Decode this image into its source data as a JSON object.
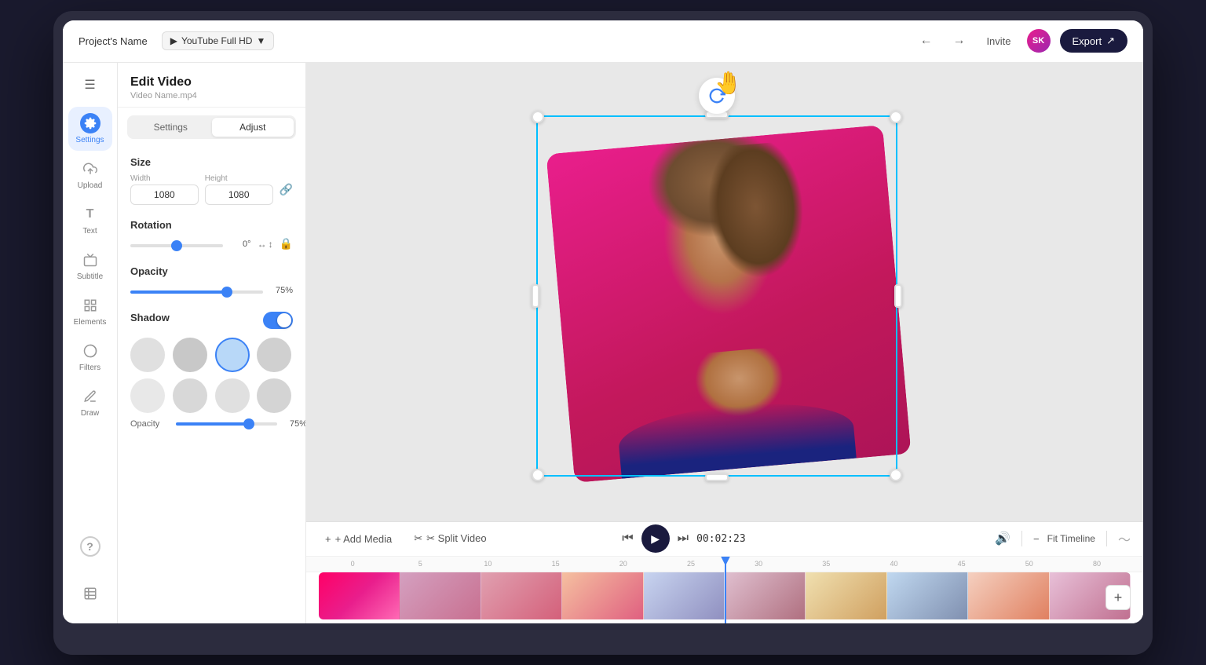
{
  "header": {
    "project_name": "Project's Name",
    "format_label": "YouTube Full HD",
    "undo_icon": "←",
    "redo_icon": "→",
    "invite_label": "Invite",
    "user_initials": "SK",
    "export_label": "Export",
    "share_icon": "↗"
  },
  "left_toolbar": {
    "menu_icon": "☰",
    "items": [
      {
        "id": "settings",
        "label": "Settings",
        "icon": "⚙",
        "active": true
      },
      {
        "id": "upload",
        "label": "Upload",
        "icon": "↑",
        "active": false
      },
      {
        "id": "text",
        "label": "Text",
        "icon": "T",
        "active": false
      },
      {
        "id": "subtitle",
        "label": "Subtitle",
        "icon": "≡",
        "active": false
      },
      {
        "id": "elements",
        "label": "Elements",
        "icon": "❖",
        "active": false
      },
      {
        "id": "filters",
        "label": "Filters",
        "icon": "◐",
        "active": false
      },
      {
        "id": "draw",
        "label": "Draw",
        "icon": "✏",
        "active": false
      }
    ],
    "bottom_items": [
      {
        "id": "help",
        "icon": "?",
        "label": ""
      },
      {
        "id": "notes",
        "icon": "📋",
        "label": ""
      }
    ]
  },
  "settings_panel": {
    "title": "Edit Video",
    "subtitle": "Video Name.mp4",
    "tabs": [
      {
        "label": "Settings",
        "active": false
      },
      {
        "label": "Adjust",
        "active": true
      }
    ],
    "size_section": {
      "title": "Size",
      "width_label": "Width",
      "width_value": "1080",
      "height_label": "Height",
      "height_value": "1080",
      "link_icon": "🔗"
    },
    "rotation_section": {
      "title": "Rotation",
      "value": "0°",
      "flip_h_icon": "↔",
      "flip_v_icon": "↕",
      "lock_icon": "🔒"
    },
    "opacity_section": {
      "title": "Opacity",
      "value": "75%",
      "slider_percent": 75
    },
    "shadow_section": {
      "title": "Shadow",
      "enabled": true,
      "swatches": [
        {
          "color": "#e0e0e0",
          "selected": false
        },
        {
          "color": "#c8c8c8",
          "selected": false
        },
        {
          "color": "#b8d8f8",
          "selected": true
        },
        {
          "color": "#d0d0d0",
          "selected": false
        },
        {
          "color": "#e8e8e8",
          "selected": false
        },
        {
          "color": "#d8d8d8",
          "selected": false
        },
        {
          "color": "#e0e0e0",
          "selected": false
        },
        {
          "color": "#d4d4d4",
          "selected": false
        }
      ],
      "opacity_label": "Opacity",
      "opacity_value": "75%",
      "opacity_percent": 75
    }
  },
  "timeline": {
    "add_media_label": "+ Add Media",
    "split_video_label": "✂ Split Video",
    "prev_frame_icon": "⏮",
    "next_frame_icon": "⏭",
    "play_icon": "▶",
    "time_display": "00:02:23",
    "volume_icon": "🔊",
    "fit_timeline_label": "Fit Timeline",
    "minus_icon": "−",
    "waveform_icon": "〜",
    "ruler_ticks": [
      "0",
      "5",
      "10",
      "15",
      "20",
      "25",
      "30",
      "35",
      "40",
      "45",
      "50",
      "80"
    ],
    "add_icon": "+"
  }
}
